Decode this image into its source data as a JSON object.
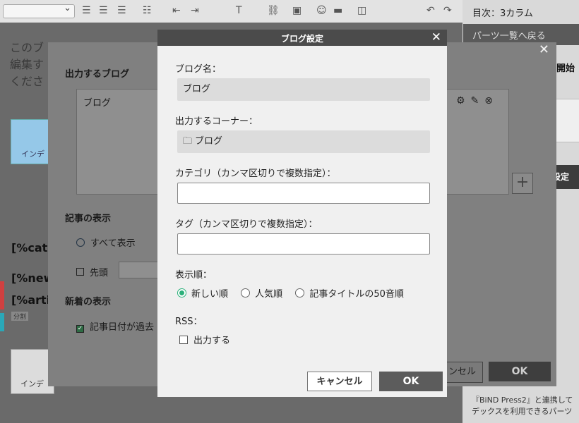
{
  "right_panel": {
    "title": "目次：3カラム",
    "back_label": "パーツ一覧へ戻る",
    "start_label": "開始",
    "setting_label": "設定",
    "footer_line1": "『BiND Press2』と連携して",
    "footer_line2": "デックスを利用できるパーツ"
  },
  "editor": {
    "text_line1": "このブ",
    "text_line2": "編集す",
    "text_line3": "くださ",
    "blue_card_label": "インデ",
    "mark_cate": "[%cate",
    "mark_new": "[%new",
    "mark_artic": "[%artic",
    "tag_label": "分割",
    "card_label": "インデ"
  },
  "middle_dialog": {
    "heading_output": "出力するブログ",
    "blog_item": "ブログ",
    "heading_display": "記事の表示",
    "radio_all": "すべて表示",
    "check_first": "先頭",
    "heading_new": "新着の表示",
    "check_date": "記事日付が過去",
    "cancel_label": "ンセル",
    "ok_label": "OK"
  },
  "modal": {
    "title": "ブログ設定",
    "blog_name_label": "ブログ名：",
    "blog_name_value": "ブログ",
    "corner_label": "出力するコーナー：",
    "corner_value": "ブログ",
    "category_label": "カテゴリ（カンマ区切りで複数指定）：",
    "category_value": "",
    "tag_label": "タグ（カンマ区切りで複数指定）：",
    "tag_value": "",
    "sort_label": "表示順：",
    "sort_options": [
      "新しい順",
      "人気順",
      "記事タイトルの50音順"
    ],
    "sort_selected": "新しい順",
    "rss_label": "RSS：",
    "rss_checkbox_label": "出力する",
    "rss_checked": false,
    "cancel_label": "キャンセル",
    "ok_label": "OK"
  },
  "colors": {
    "accent_green": "#2bb07a",
    "header_dark": "#4b4b4b",
    "ok_button": "#5c5c5c"
  }
}
